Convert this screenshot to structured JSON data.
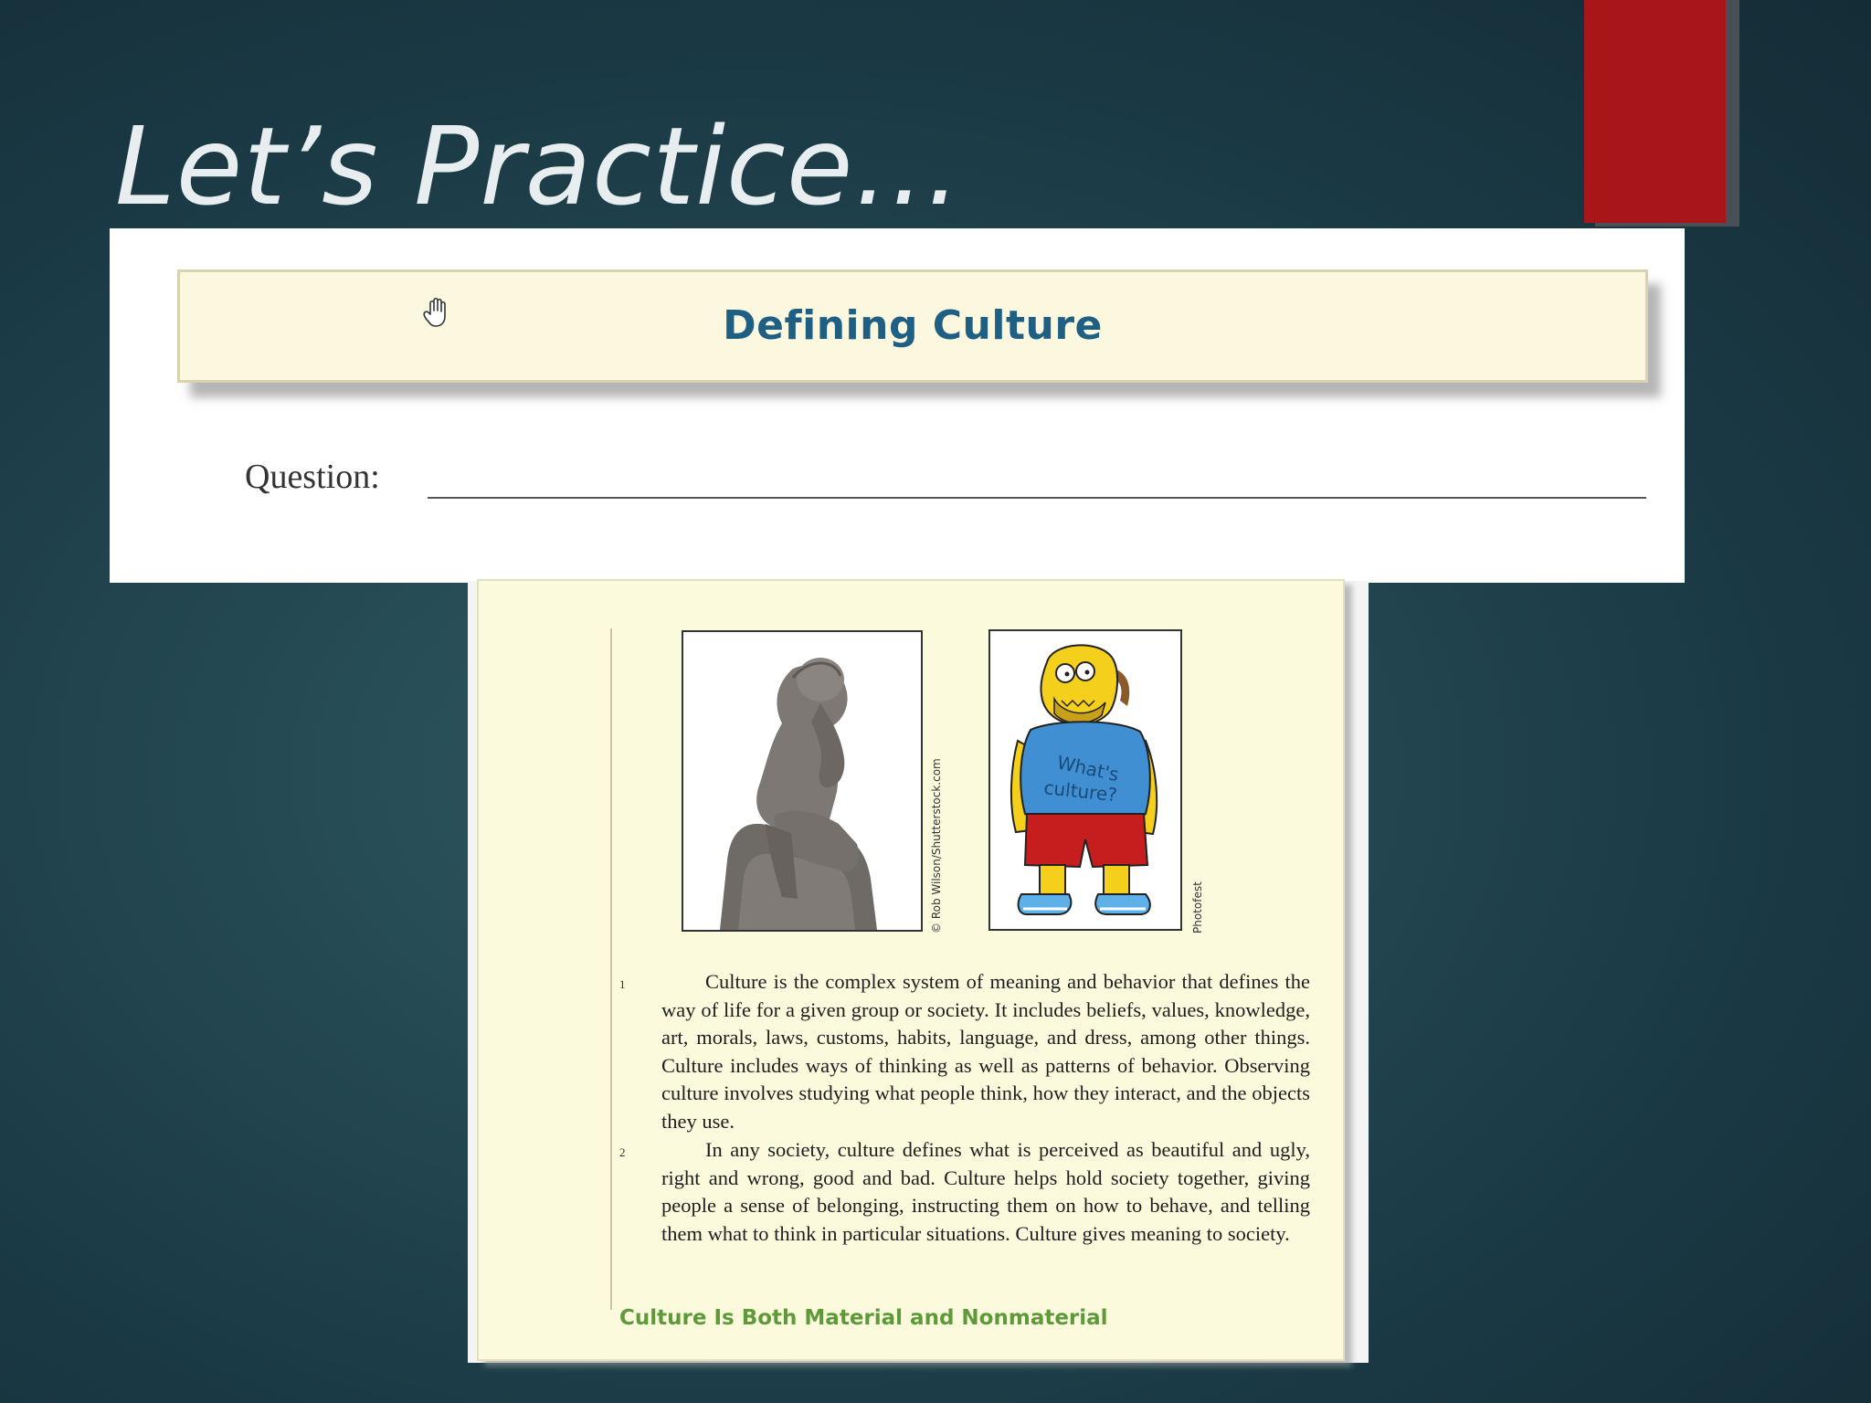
{
  "slide": {
    "title": "Let’s Practice…"
  },
  "worksheet": {
    "banner_title": "Defining Culture",
    "question_label": "Question:"
  },
  "textbook": {
    "image_credits": [
      "© Rob Wilson/Shutterstock.com",
      "Photofest"
    ],
    "shirt_text_line1": "What's",
    "shirt_text_line2": "culture?",
    "paragraph_numbers": [
      "1",
      "2"
    ],
    "paragraph_1": "Culture is the complex system of meaning and behavior that defines the way of life for a given group or society. It includes beliefs, values, knowledge, art, morals, laws, customs, habits, language, and dress, among other things. Culture includes ways of thinking as well as patterns of behavior. Observing culture involves studying what people think, how they interact, and the objects they use.",
    "paragraph_2": "In any society, culture defines what is perceived as beautiful and ugly, right and wrong, good and bad. Culture helps hold society together, giving people a sense of belonging, instructing them on how to behave, and telling them what to think in particular situations. Culture gives meaning to society.",
    "section_heading": "Culture Is Both Material and Nonmaterial"
  },
  "colors": {
    "background": "#1f434e",
    "accent": "#a81619",
    "banner_fill": "#fbf8df",
    "banner_text": "#1f5f84",
    "section_heading": "#5e9a3a"
  },
  "icons": [
    "hand-cursor-icon"
  ]
}
